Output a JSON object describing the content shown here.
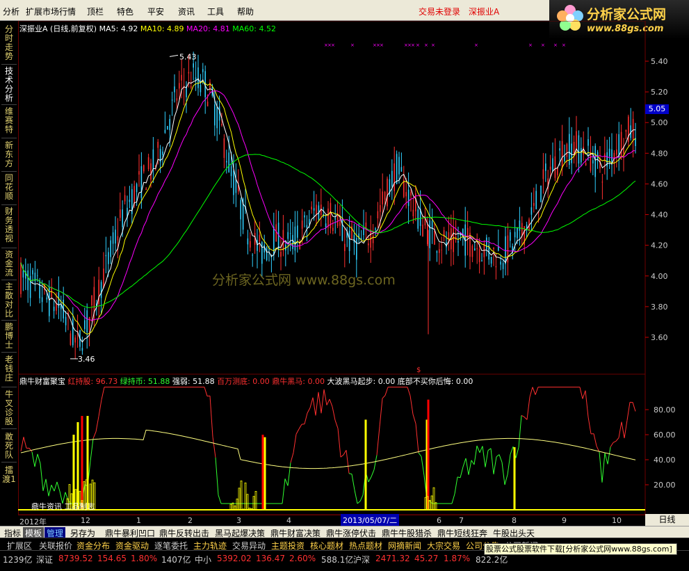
{
  "menu": {
    "items": [
      "分析",
      "扩展市场行情",
      "资讯",
      "特色",
      "平安",
      "资讯",
      "工具",
      "帮助"
    ],
    "status_trade": "交易未登录",
    "status_stock": "深振业A"
  },
  "logo": {
    "title": "分析家公式网",
    "url": "www.88gs.com"
  },
  "leftbar": {
    "tabs": [
      "分时走势",
      "技术分析",
      "维赛特",
      "新东方",
      "同花顺",
      "财务透视",
      "资金流",
      "主散对比",
      "鹏博士",
      "老钱庄",
      "牛叉诊股",
      "敢死队",
      "擂渡1"
    ],
    "active_index": 1
  },
  "ma_legend": {
    "title": "深振业A (日线,前复权)",
    "items": [
      {
        "label": "MA5: 4.92",
        "color": "#ffffff"
      },
      {
        "label": "MA10: 4.89",
        "color": "#ffff00"
      },
      {
        "label": "MA20: 4.81",
        "color": "#ff00ff"
      },
      {
        "label": "MA60: 4.52",
        "color": "#00ff00"
      }
    ]
  },
  "indicator_legend": {
    "title": "鼎牛财富聚宝",
    "items": [
      {
        "label": "红持股: 96.73",
        "color": "#ff3030"
      },
      {
        "label": "绿持币: 51.88",
        "color": "#30ff30"
      },
      {
        "label": "强弱: 51.88",
        "color": "#ffffff"
      },
      {
        "label": "百万测底: 0.00",
        "color": "#ff3030"
      },
      {
        "label": "鼎牛黑马: 0.00",
        "color": "#ff3030"
      },
      {
        "label": "大波黑马起步: 0.00",
        "color": "#ffffff"
      },
      {
        "label": "底部不买你后悔: 0.00",
        "color": "#ffffff"
      }
    ]
  },
  "price_axis": [
    "5.40",
    "5.20",
    "5.00",
    "4.80",
    "4.60",
    "4.40",
    "4.20",
    "4.00",
    "3.80",
    "3.60"
  ],
  "ind_axis": [
    "80.00",
    "60.00",
    "40.00",
    "20.00"
  ],
  "current_price": "5.05",
  "high_marker": "5.43",
  "low_marker": "3.46",
  "watermark": "分析家公式网 www.88gs.com",
  "bottom_label": "鼎牛资讯 工品制志",
  "time_axis": [
    "2012年",
    "12",
    "1",
    "2",
    "3",
    "4",
    "6",
    "7",
    "8",
    "9",
    "10"
  ],
  "selected_date": "2013/05/07/二",
  "period_button": "日线",
  "tabs": [
    "指标",
    "模板",
    "管理",
    "另存为",
    "鼎牛暴利凹口",
    "鼎牛反转出击",
    "黑马起爆决策",
    "鼎牛财富决策",
    "鼎牛涨停伏击",
    "鼎牛牛股猎杀",
    "鼎牛短线狂奔",
    "牛股出头天"
  ],
  "tabs2": [
    "扩展区",
    "关联报价",
    "资金分布",
    "资金驱动",
    "逐笔委托",
    "主力轨迹",
    "交易异动",
    "主题投资",
    "核心题材",
    "热点题材",
    "网摘新闻",
    "大宗交易",
    "公司公告",
    "公司新闻"
  ],
  "ticker": [
    {
      "t": "1239亿",
      "c": "#cccccc"
    },
    {
      "t": "深证",
      "c": "#cccccc"
    },
    {
      "t": "8739.52",
      "c": "#ff3030"
    },
    {
      "t": "154.65",
      "c": "#ff3030"
    },
    {
      "t": "1.80%",
      "c": "#ff3030"
    },
    {
      "t": "1407亿",
      "c": "#cccccc"
    },
    {
      "t": "中小",
      "c": "#cccccc"
    },
    {
      "t": "5392.02",
      "c": "#ff3030"
    },
    {
      "t": "136.47",
      "c": "#ff3030"
    },
    {
      "t": "2.60%",
      "c": "#ff3030"
    },
    {
      "t": "588.1亿",
      "c": "#cccccc"
    },
    {
      "t": "沪深",
      "c": "#cccccc"
    },
    {
      "t": "2471.32",
      "c": "#ff3030"
    },
    {
      "t": "45.27",
      "c": "#ff3030"
    },
    {
      "t": "1.87%",
      "c": "#ff3030"
    },
    {
      "t": "822.2亿",
      "c": "#cccccc"
    }
  ],
  "ad_text": "股票公式股票软件下载[分析家公式网www.88gs.com]",
  "colors": {
    "up": "#ff3030",
    "down": "#30d0ff",
    "ma5": "#ffffff",
    "ma10": "#ffff00",
    "ma20": "#ff00ff",
    "ma60": "#00ff00"
  }
}
